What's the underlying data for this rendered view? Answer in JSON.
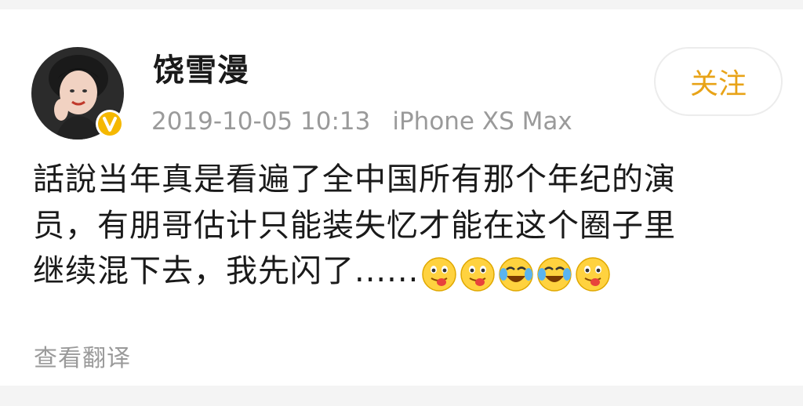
{
  "post": {
    "author": "饶雪漫",
    "timestamp": "2019-10-05 10:13",
    "device": "iPhone XS Max",
    "follow_label": "关注",
    "text_lines": [
      "話說当年真是看遍了全中国所有那个年纪的演",
      "员，有朋哥估计只能装失忆才能在这个圈子里",
      "继续混下去，我先闪了......"
    ],
    "emojis": [
      "tongue-emoji",
      "tongue-emoji",
      "laugh-cry-emoji",
      "laugh-cry-emoji",
      "tongue-emoji"
    ],
    "translate_label": "查看翻译"
  },
  "colors": {
    "accent": "#e8a317",
    "badge": "#f5b800",
    "meta_text": "#9a9a9a"
  }
}
